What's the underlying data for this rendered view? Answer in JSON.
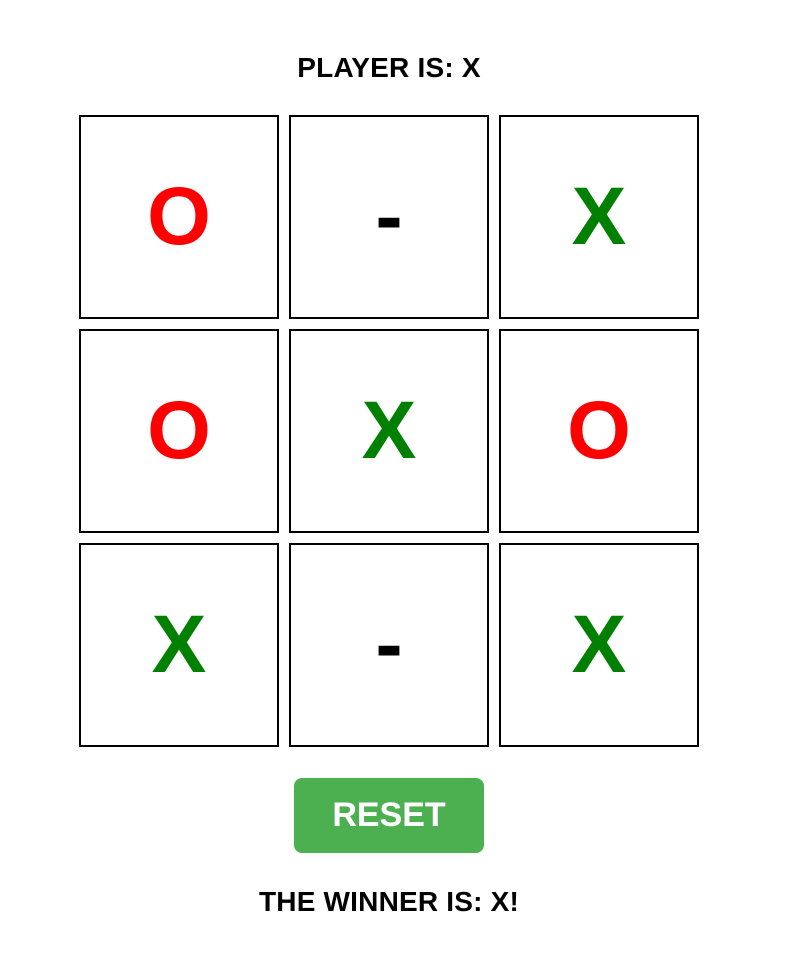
{
  "status": {
    "player_label": "PLAYER IS: X",
    "winner_label": "THE WINNER IS: X!"
  },
  "board": {
    "cells": [
      "O",
      "-",
      "X",
      "O",
      "X",
      "O",
      "X",
      "-",
      "X"
    ]
  },
  "controls": {
    "reset_label": "RESET"
  },
  "colors": {
    "x_mark": "#008000",
    "o_mark": "#ff0000",
    "empty_mark": "#000000",
    "reset_button": "#4caf50"
  }
}
